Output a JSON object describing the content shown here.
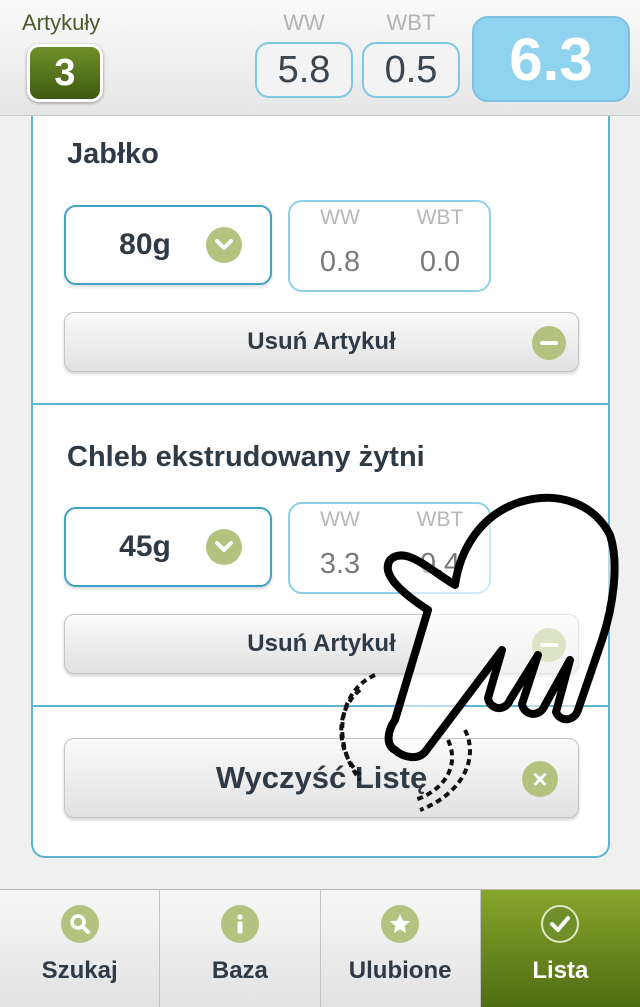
{
  "header": {
    "count_label": "Artykuły",
    "count_value": "3",
    "ww_label": "WW",
    "wbt_label": "WBT",
    "ww_value": "5.8",
    "wbt_value": "0.5",
    "total_value": "6.3"
  },
  "items": [
    {
      "name": "Jabłko",
      "quantity": "80g",
      "ww_label": "WW",
      "wbt_label": "WBT",
      "ww_value": "0.8",
      "wbt_value": "0.0",
      "remove_label": "Usuń Artykuł"
    },
    {
      "name": "Chleb ekstrudowany żytni",
      "quantity": "45g",
      "ww_label": "WW",
      "wbt_label": "WBT",
      "ww_value": "3.3",
      "wbt_value": "0.4",
      "remove_label": "Usuń Artykuł"
    }
  ],
  "clear_label": "Wyczyść Listę",
  "tabs": [
    {
      "label": "Szukaj",
      "icon": "search-icon"
    },
    {
      "label": "Baza",
      "icon": "info-icon"
    },
    {
      "label": "Ulubione",
      "icon": "star-icon"
    },
    {
      "label": "Lista",
      "icon": "check-icon",
      "active": true
    }
  ],
  "colors": {
    "accent_blue": "#5fb3d3",
    "total_bg": "#8fd3ef",
    "green_active": "#4f6d12",
    "icon_green": "#b4c27f"
  }
}
